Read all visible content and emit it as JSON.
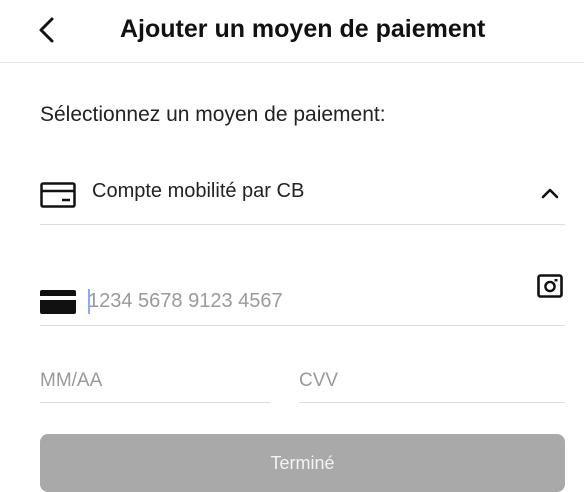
{
  "header": {
    "back_icon": "chevron-left-icon",
    "title": "Ajouter un moyen de paiement"
  },
  "prompt": "Sélectionnez un moyen de paiement:",
  "method": {
    "icon": "card-outline-icon",
    "label": "Compte mobilité par CB",
    "expand_icon": "chevron-up-icon"
  },
  "card_number": {
    "icon": "credit-card-icon",
    "placeholder": "1234 5678 9123 4567",
    "value": "",
    "scan_icon": "camera-icon"
  },
  "expiry": {
    "placeholder": "MM/AA",
    "value": ""
  },
  "cvv": {
    "placeholder": "CVV",
    "value": ""
  },
  "done_button": {
    "label": "Terminé"
  },
  "colors": {
    "button_bg": "#a9a9a9",
    "button_text": "#f4f4f4",
    "divider": "#dcdcdc",
    "caret": "#8aa8ff",
    "placeholder": "#9a9a9a"
  }
}
